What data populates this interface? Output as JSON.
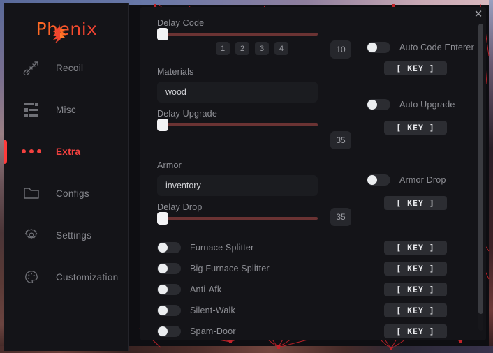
{
  "app": {
    "brand_prefix": "Ph",
    "brand_suffix": "enix",
    "close_label": "✕",
    "accent": "#f2413f",
    "slider_track": "#6b3333"
  },
  "sidebar": {
    "items": [
      {
        "label": "Recoil",
        "icon": "rifle-icon",
        "active": false
      },
      {
        "label": "Misc",
        "icon": "sliders-icon",
        "active": false
      },
      {
        "label": "Extra",
        "icon": "three-dots-icon",
        "active": true
      },
      {
        "label": "Configs",
        "icon": "folder-icon",
        "active": false
      },
      {
        "label": "Settings",
        "icon": "gear-icon",
        "active": false
      },
      {
        "label": "Customization",
        "icon": "palette-icon",
        "active": false
      }
    ]
  },
  "main": {
    "delay_code": {
      "label": "Delay Code",
      "value": "10",
      "thumb_percent": 2,
      "numbers": [
        "1",
        "2",
        "3",
        "4"
      ]
    },
    "materials": {
      "label": "Materials",
      "value": "wood",
      "placeholder": "wood"
    },
    "delay_upgrade": {
      "label": "Delay Upgrade",
      "value": "35",
      "thumb_percent": 2
    },
    "armor": {
      "label": "Armor",
      "value": "inventory",
      "placeholder": "inventory"
    },
    "delay_drop": {
      "label": "Delay Drop",
      "value": "35",
      "thumb_percent": 2
    },
    "right_toggles": [
      {
        "label": "Auto Code Enterer",
        "on": false,
        "key_label": "[ KEY ]"
      },
      {
        "label": "Auto Upgrade",
        "on": false,
        "key_label": "[ KEY ]"
      },
      {
        "label": "Armor Drop",
        "on": false,
        "key_label": "[ KEY ]"
      }
    ],
    "feature_toggles": [
      {
        "label": "Furnace Splitter",
        "on": false,
        "key_label": "[ KEY ]"
      },
      {
        "label": "Big Furnace Splitter",
        "on": false,
        "key_label": "[ KEY ]"
      },
      {
        "label": "Anti-Afk",
        "on": false,
        "key_label": "[ KEY ]"
      },
      {
        "label": "Silent-Walk",
        "on": false,
        "key_label": "[ KEY ]"
      },
      {
        "label": "Spam-Door",
        "on": false,
        "key_label": "[ KEY ]"
      }
    ]
  }
}
